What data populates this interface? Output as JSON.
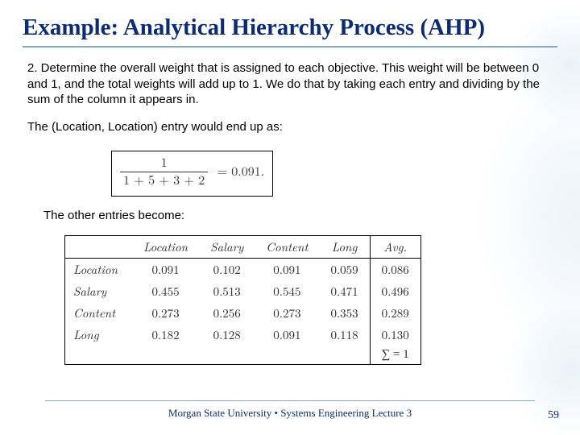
{
  "title": "Example: Analytical Hierarchy Process (AHP)",
  "para1": "2. Determine the overall weight that is assigned to each objective. This weight will be between 0 and 1, and the total weights will add up to 1. We do that by taking each entry and dividing by the sum of the column it appears in.",
  "para2": "The (Location, Location) entry would end up as:",
  "eq": {
    "num": "1",
    "den": "1 + 5 + 3 + 2",
    "rhs": "= 0.091."
  },
  "para3": "The other entries become:",
  "table": {
    "headers": [
      "",
      "Location",
      "Salary",
      "Content",
      "Long",
      "Avg."
    ],
    "rows": [
      {
        "label": "Location",
        "vals": [
          "0.091",
          "0.102",
          "0.091",
          "0.059"
        ],
        "avg": "0.086"
      },
      {
        "label": "Salary",
        "vals": [
          "0.455",
          "0.513",
          "0.545",
          "0.471"
        ],
        "avg": "0.496"
      },
      {
        "label": "Content",
        "vals": [
          "0.273",
          "0.256",
          "0.273",
          "0.353"
        ],
        "avg": "0.289"
      },
      {
        "label": "Long",
        "vals": [
          "0.182",
          "0.128",
          "0.091",
          "0.118"
        ],
        "avg": "0.130"
      }
    ],
    "sum": "∑ = 1"
  },
  "footer": "Morgan State University  •  Systems Engineering Lecture 3",
  "page": "59"
}
